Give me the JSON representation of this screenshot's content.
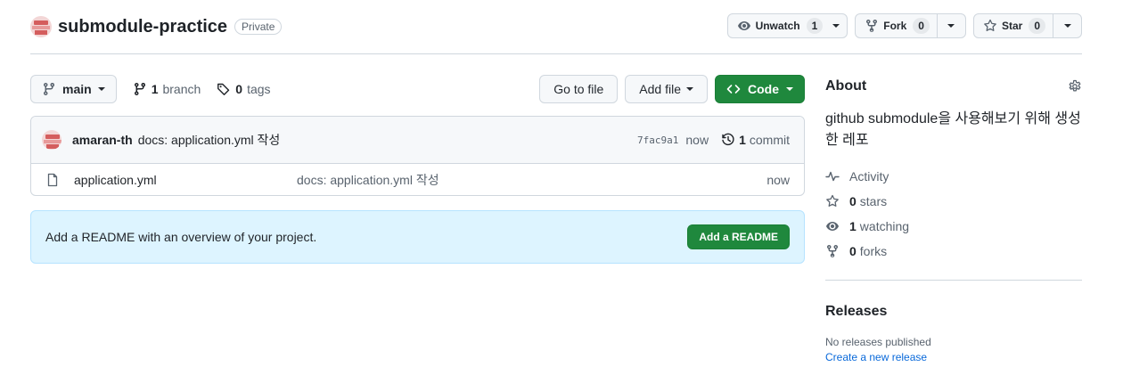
{
  "repo": {
    "name": "submodule-practice",
    "visibility": "Private"
  },
  "header_actions": {
    "unwatch_label": "Unwatch",
    "unwatch_count": "1",
    "fork_label": "Fork",
    "fork_count": "0",
    "star_label": "Star",
    "star_count": "0"
  },
  "toolbar": {
    "branch": "main",
    "branch_count": "1",
    "branch_word": "branch",
    "tag_count": "0",
    "tag_word": "tags",
    "go_to_file": "Go to file",
    "add_file": "Add file",
    "code": "Code"
  },
  "latest_commit": {
    "author": "amaran-th",
    "message": "docs: application.yml 작성",
    "sha": "7fac9a1",
    "time": "now",
    "commit_count": "1",
    "commit_word": "commit"
  },
  "files": [
    {
      "name": "application.yml",
      "message": "docs: application.yml 작성",
      "time": "now"
    }
  ],
  "readme_banner": {
    "text": "Add a README with an overview of your project.",
    "button": "Add a README"
  },
  "about": {
    "title": "About",
    "description": "github submodule을 사용해보기 위해 생성한 레포",
    "activity": "Activity",
    "stars_count": "0",
    "stars_word": "stars",
    "watching_count": "1",
    "watching_word": "watching",
    "forks_count": "0",
    "forks_word": "forks"
  },
  "releases": {
    "title": "Releases",
    "none_text": "No releases published",
    "create_link": "Create a new release"
  },
  "colors": {
    "accent_green": "#1f883d",
    "link_blue": "#0969da",
    "banner_bg": "#ddf4ff"
  }
}
